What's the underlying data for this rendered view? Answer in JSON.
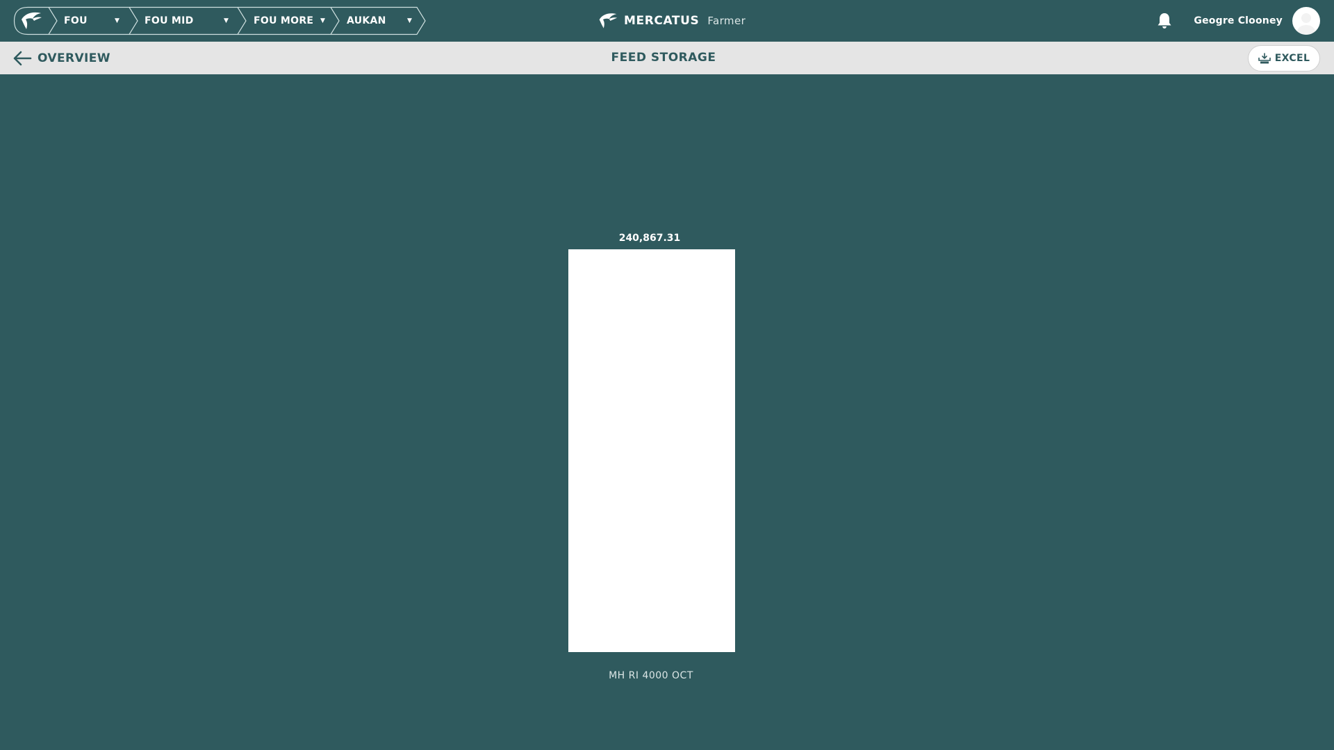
{
  "breadcrumbs": [
    {
      "label": "FOU"
    },
    {
      "label": "FOU MID"
    },
    {
      "label": "FOU MORE"
    },
    {
      "label": "AUKAN"
    }
  ],
  "brand": {
    "name": "MERCATUS",
    "role": "Farmer"
  },
  "user": {
    "name": "Geogre Clooney"
  },
  "subbar": {
    "back_label": "OVERVIEW",
    "title": "FEED STORAGE",
    "excel_label": "EXCEL"
  },
  "icons": {
    "logo": "salmon-logo-icon",
    "bell": "bell-icon",
    "back": "arrow-left-icon",
    "excel": "xls-download-icon",
    "caret": "caret-down-icon"
  },
  "colors": {
    "background": "#2f5a5e",
    "subbar": "#e5e5e5",
    "bar": "#ffffff",
    "text_light": "#ffffff",
    "text_dark": "#2f5a5e"
  },
  "chart_data": {
    "type": "bar",
    "categories": [
      "MH RI 4000 OCT"
    ],
    "values": [
      240867.31
    ],
    "data_labels": [
      "240,867.31"
    ],
    "ylim": [
      0,
      240867.31
    ],
    "grid": false,
    "legend": "none"
  }
}
